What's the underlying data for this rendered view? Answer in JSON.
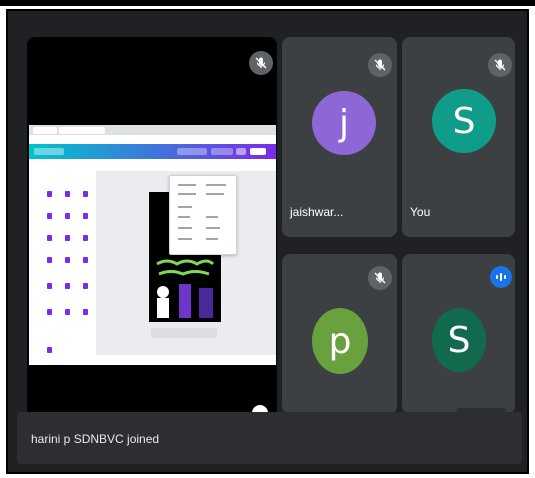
{
  "participants": [
    {
      "initial": "j",
      "name": "jaishwar...",
      "color": "#8e67d6",
      "muted": true
    },
    {
      "initial": "S",
      "name": "You",
      "color": "#0f9d8a",
      "muted": true
    },
    {
      "initial": "p",
      "name": "",
      "color": "#6aa13f",
      "muted": true
    },
    {
      "initial": "S",
      "name": "",
      "color": "#116a4e",
      "muted": false,
      "speaking": true
    }
  ],
  "notification": {
    "text": "harini p SDNBVC joined"
  },
  "icons": {
    "mic_off": "mic-off-icon",
    "speaking": "speaking-indicator-icon"
  }
}
